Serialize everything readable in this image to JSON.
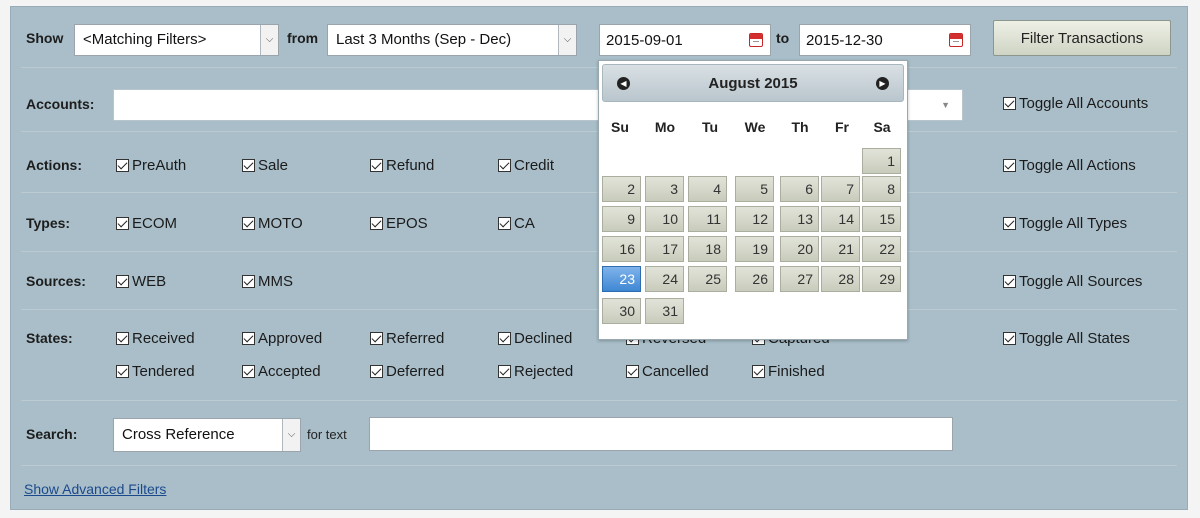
{
  "toolbar": {
    "show_label": "Show",
    "show_value": "<Matching Filters>",
    "from_label": "from",
    "period_value": "Last 3 Months (Sep - Dec)",
    "date_from": "2015-09-01",
    "to_label": "to",
    "date_to": "2015-12-30",
    "filter_button": "Filter Transactions"
  },
  "accounts": {
    "label": "Accounts:",
    "toggle": "Toggle All Accounts"
  },
  "actions": {
    "label": "Actions:",
    "items": [
      "PreAuth",
      "Sale",
      "Refund",
      "Credit"
    ],
    "toggle": "Toggle All Actions"
  },
  "types": {
    "label": "Types:",
    "items": [
      "ECOM",
      "MOTO",
      "EPOS",
      "CA"
    ],
    "toggle": "Toggle All Types"
  },
  "sources": {
    "label": "Sources:",
    "items": [
      "WEB",
      "MMS"
    ],
    "toggle": "Toggle All Sources"
  },
  "states": {
    "label": "States:",
    "row1": [
      "Received",
      "Approved",
      "Referred",
      "Declined",
      "Reversed",
      "Captured"
    ],
    "row2": [
      "Tendered",
      "Accepted",
      "Deferred",
      "Rejected",
      "Cancelled",
      "Finished"
    ],
    "toggle": "Toggle All States"
  },
  "search": {
    "label": "Search:",
    "field_value": "Cross Reference",
    "for_text_label": "for text",
    "text_value": ""
  },
  "advanced_link": "Show Advanced Filters",
  "calendar": {
    "title": "August 2015",
    "weekdays": [
      "Su",
      "Mo",
      "Tu",
      "We",
      "Th",
      "Fr",
      "Sa"
    ],
    "selected_day": "23",
    "days": [
      "1",
      "2",
      "3",
      "4",
      "5",
      "6",
      "7",
      "8",
      "9",
      "10",
      "11",
      "12",
      "13",
      "14",
      "15",
      "16",
      "17",
      "18",
      "19",
      "20",
      "21",
      "22",
      "23",
      "24",
      "25",
      "26",
      "27",
      "28",
      "29",
      "30",
      "31"
    ]
  },
  "colors": {
    "panel": "#a9bec9",
    "selected_day": "#3f87d4"
  }
}
